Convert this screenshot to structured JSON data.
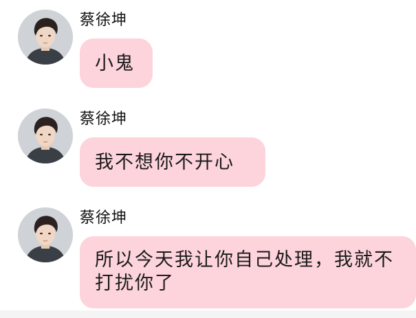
{
  "messages": [
    {
      "sender": "蔡徐坤",
      "text": "小鬼"
    },
    {
      "sender": "蔡徐坤",
      "text": "我不想你不开心"
    },
    {
      "sender": "蔡徐坤",
      "text": "所以今天我让你自己处理，我就不打扰你了"
    }
  ],
  "colors": {
    "bubble": "#fdd3dc",
    "background": "#ffffff"
  }
}
